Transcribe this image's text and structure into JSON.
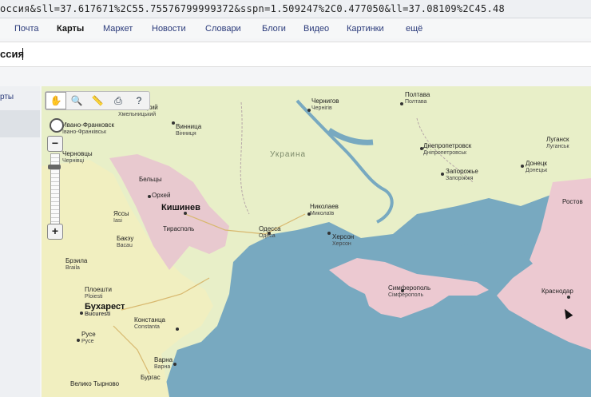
{
  "url": "оссия&sll=37.617671%2C55.75576799999372&sspn=1.509247%2C0.477050&ll=37.08109%2C45.48",
  "services": [
    {
      "label": "Почта",
      "active": false
    },
    {
      "label": "Карты",
      "active": true
    },
    {
      "label": "Маркет",
      "active": false
    },
    {
      "label": "Новости",
      "active": false
    },
    {
      "label": "Словари",
      "active": false
    },
    {
      "label": "Блоги",
      "active": false
    },
    {
      "label": "Видео",
      "active": false
    },
    {
      "label": "Картинки",
      "active": false
    },
    {
      "label": "ещё",
      "active": false
    }
  ],
  "search": {
    "value": "ссия"
  },
  "left_tab": "рты",
  "map": {
    "country_ukraine": "Украина",
    "cities": [
      {
        "id": "chernigov",
        "name": "Чернигов",
        "sub": "Чернігів"
      },
      {
        "id": "poltava",
        "name": "Полтава",
        "sub": "Полтава"
      },
      {
        "id": "khmelnitsky",
        "name": "Хмельницкий",
        "sub": "Хмельницький"
      },
      {
        "id": "vinnitsa",
        "name": "Винница",
        "sub": "Вінниця"
      },
      {
        "id": "ivano",
        "name": "Ивано-Франковск",
        "sub": "Івано-Франківськ"
      },
      {
        "id": "chernovtsy",
        "name": "Черновцы",
        "sub": "Чернівці"
      },
      {
        "id": "dnepr",
        "name": "Днепропетровск",
        "sub": "Дніпропетровськ"
      },
      {
        "id": "lugansk",
        "name": "Луганск",
        "sub": "Луганськ"
      },
      {
        "id": "zaporozhye",
        "name": "Запорожье",
        "sub": "Запоріжжя"
      },
      {
        "id": "donetsk",
        "name": "Донецк",
        "sub": "Донецьк"
      },
      {
        "id": "beltsy",
        "name": "Бельцы",
        "sub": ""
      },
      {
        "id": "orhei",
        "name": "Орхей",
        "sub": ""
      },
      {
        "id": "chisinau",
        "name": "Кишинев",
        "sub": ""
      },
      {
        "id": "tiraspol",
        "name": "Тирасполь",
        "sub": ""
      },
      {
        "id": "iasi",
        "name": "Яссы",
        "sub": "Iasi"
      },
      {
        "id": "bacau",
        "name": "Бакэу",
        "sub": "Bacau"
      },
      {
        "id": "nikolaev",
        "name": "Николаев",
        "sub": "Миколаїв"
      },
      {
        "id": "odessa",
        "name": "Одесса",
        "sub": "Одеса"
      },
      {
        "id": "kherson",
        "name": "Херсон",
        "sub": "Херсон"
      },
      {
        "id": "braila",
        "name": "Брэила",
        "sub": "Braila"
      },
      {
        "id": "ploiesti",
        "name": "Плоешти",
        "sub": "Ploiesti"
      },
      {
        "id": "bucharest",
        "name": "Бухарест",
        "sub": "Bucuresti"
      },
      {
        "id": "constanta",
        "name": "Констанца",
        "sub": "Constanta"
      },
      {
        "id": "ruse",
        "name": "Русе",
        "sub": "Русе"
      },
      {
        "id": "varna",
        "name": "Варна",
        "sub": "Варна"
      },
      {
        "id": "simferopol",
        "name": "Симферополь",
        "sub": "Сімферополь"
      },
      {
        "id": "krasnodar",
        "name": "Краснодар",
        "sub": ""
      },
      {
        "id": "rostov",
        "name": "Ростов",
        "sub": ""
      },
      {
        "id": "burgas",
        "name": "Бургас",
        "sub": ""
      },
      {
        "id": "veliko",
        "name": "Велико Тырново",
        "sub": ""
      }
    ],
    "colors": {
      "sea": "#78a9c0",
      "ukraine": "#e8efc8",
      "moldova": "#e8c9cf",
      "romania": "#f1efc0",
      "russia": "#ecc9d1",
      "crimea": "#ecc9d1"
    }
  }
}
